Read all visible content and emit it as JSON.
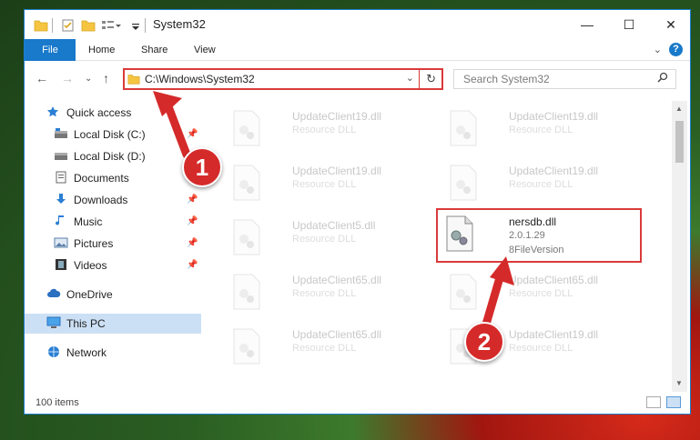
{
  "window": {
    "title": "System32"
  },
  "ribbon": {
    "tabs": [
      "File",
      "Home",
      "Share",
      "View"
    ],
    "help": "?"
  },
  "nav": {
    "path": "C:\\Windows\\System32",
    "search_placeholder": "Search System32"
  },
  "sidebar": {
    "quick_access": "Quick access",
    "items": [
      {
        "label": "Local Disk (C:)",
        "icon": "drive-icon",
        "pinned": true
      },
      {
        "label": "Local Disk (D:)",
        "icon": "drive-icon",
        "pinned": false
      },
      {
        "label": "Documents",
        "icon": "documents-icon",
        "pinned": false
      },
      {
        "label": "Downloads",
        "icon": "downloads-icon",
        "pinned": true
      },
      {
        "label": "Music",
        "icon": "music-icon",
        "pinned": true
      },
      {
        "label": "Pictures",
        "icon": "pictures-icon",
        "pinned": true
      },
      {
        "label": "Videos",
        "icon": "videos-icon",
        "pinned": true
      }
    ],
    "onedrive": "OneDrive",
    "this_pc": "This PC",
    "network": "Network"
  },
  "files": [
    {
      "name": "UpdateClient19.dll",
      "desc": "Resource DLL"
    },
    {
      "name": "UpdateClient19.dll",
      "desc": "Resource DLL"
    },
    {
      "name": "UpdateClient19.dll",
      "desc": "Resource DLL"
    },
    {
      "name": "UpdateClient19.dll",
      "desc": "Resource DLL"
    },
    {
      "name": "UpdateClient5.dll",
      "desc": "Resource DLL"
    },
    {
      "name": "nersdb.dll",
      "version": "2.0.1.29",
      "desc": "8FileVersion"
    },
    {
      "name": "UpdateClient65.dll",
      "desc": "Resource DLL"
    },
    {
      "name": "UpdateClient65.dll",
      "desc": "Resource DLL"
    },
    {
      "name": "UpdateClient65.dll",
      "desc": "Resource DLL"
    },
    {
      "name": "UpdateClient19.dll",
      "desc": "Resource DLL"
    }
  ],
  "status": {
    "count": "100 items"
  },
  "callouts": [
    "1",
    "2"
  ],
  "colors": {
    "accent": "#1979ca",
    "annotation": "#d93a3a",
    "selected": "#cce0f5"
  }
}
